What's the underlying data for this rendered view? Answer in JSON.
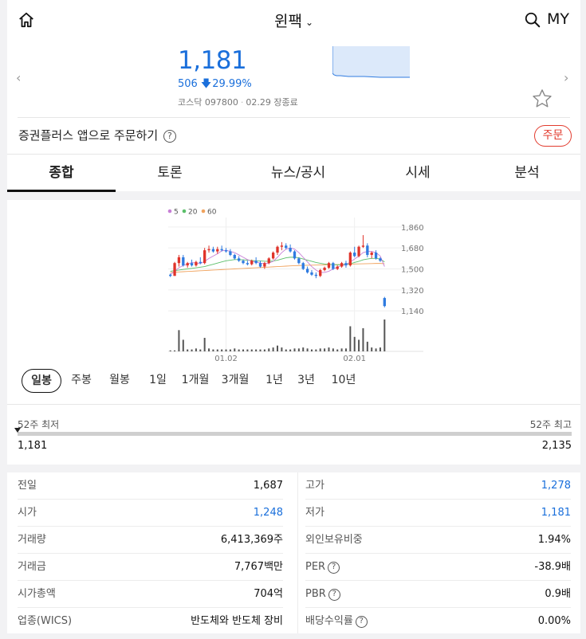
{
  "header": {
    "stock_name": "윈팩",
    "my_label": "MY"
  },
  "quote": {
    "price": "1,181",
    "change_amount": "506",
    "change_percent": "29.99%",
    "market": "코스닥",
    "code": "097800",
    "date_status": "02.29 장종료"
  },
  "order": {
    "prompt": "증권플러스 앱으로 주문하기",
    "button_label": "주문"
  },
  "tabs": [
    {
      "label": "종합",
      "active": true
    },
    {
      "label": "토론",
      "active": false
    },
    {
      "label": "뉴스/공시",
      "active": false
    },
    {
      "label": "시세",
      "active": false
    },
    {
      "label": "분석",
      "active": false
    }
  ],
  "chart_data": {
    "type": "candlestick",
    "legend": [
      "5",
      "20",
      "60"
    ],
    "legend_colors": [
      "#c77fd6",
      "#5bbf6a",
      "#f0a35e"
    ],
    "y_ticks": [
      "1,860",
      "1,680",
      "1,500",
      "1,320",
      "1,140"
    ],
    "y_tick_values": [
      1860,
      1680,
      1500,
      1320,
      1140
    ],
    "ylim": [
      1100,
      1900
    ],
    "x_ticks": [
      "01.02",
      "02.01"
    ],
    "x_tick_index": [
      13,
      43
    ],
    "up_color": "#e0332a",
    "down_color": "#2f7be0",
    "candles": [
      [
        1450,
        1460,
        1430,
        1440
      ],
      [
        1440,
        1560,
        1440,
        1550
      ],
      [
        1550,
        1620,
        1520,
        1600
      ],
      [
        1600,
        1620,
        1520,
        1530
      ],
      [
        1530,
        1560,
        1510,
        1550
      ],
      [
        1550,
        1580,
        1520,
        1530
      ],
      [
        1530,
        1570,
        1520,
        1560
      ],
      [
        1560,
        1600,
        1540,
        1550
      ],
      [
        1550,
        1680,
        1540,
        1660
      ],
      [
        1660,
        1700,
        1640,
        1670
      ],
      [
        1670,
        1690,
        1640,
        1650
      ],
      [
        1650,
        1690,
        1630,
        1670
      ],
      [
        1670,
        1700,
        1650,
        1660
      ],
      [
        1660,
        1680,
        1640,
        1650
      ],
      [
        1650,
        1670,
        1610,
        1620
      ],
      [
        1620,
        1630,
        1580,
        1590
      ],
      [
        1590,
        1610,
        1560,
        1570
      ],
      [
        1570,
        1580,
        1540,
        1550
      ],
      [
        1550,
        1570,
        1530,
        1540
      ],
      [
        1540,
        1580,
        1530,
        1570
      ],
      [
        1570,
        1600,
        1540,
        1550
      ],
      [
        1550,
        1570,
        1510,
        1520
      ],
      [
        1520,
        1560,
        1500,
        1550
      ],
      [
        1550,
        1600,
        1540,
        1590
      ],
      [
        1590,
        1650,
        1580,
        1640
      ],
      [
        1640,
        1700,
        1620,
        1690
      ],
      [
        1690,
        1730,
        1660,
        1700
      ],
      [
        1700,
        1720,
        1670,
        1680
      ],
      [
        1680,
        1710,
        1640,
        1650
      ],
      [
        1650,
        1660,
        1580,
        1590
      ],
      [
        1590,
        1600,
        1540,
        1550
      ],
      [
        1550,
        1560,
        1490,
        1500
      ],
      [
        1500,
        1520,
        1460,
        1470
      ],
      [
        1470,
        1490,
        1440,
        1450
      ],
      [
        1450,
        1470,
        1420,
        1440
      ],
      [
        1440,
        1500,
        1430,
        1490
      ],
      [
        1490,
        1520,
        1480,
        1510
      ],
      [
        1510,
        1560,
        1500,
        1550
      ],
      [
        1550,
        1560,
        1490,
        1500
      ],
      [
        1500,
        1530,
        1490,
        1520
      ],
      [
        1520,
        1560,
        1510,
        1550
      ],
      [
        1550,
        1570,
        1510,
        1530
      ],
      [
        1530,
        1650,
        1520,
        1640
      ],
      [
        1640,
        1690,
        1600,
        1610
      ],
      [
        1610,
        1700,
        1600,
        1690
      ],
      [
        1690,
        1790,
        1680,
        1700
      ],
      [
        1700,
        1720,
        1600,
        1620
      ],
      [
        1620,
        1650,
        1590,
        1640
      ],
      [
        1640,
        1660,
        1580,
        1590
      ],
      [
        1590,
        1600,
        1560,
        1570
      ],
      [
        1250,
        1260,
        1170,
        1181
      ]
    ],
    "ma5": [
      1450,
      1480,
      1510,
      1530,
      1540,
      1555,
      1550,
      1545,
      1565,
      1590,
      1610,
      1630,
      1655,
      1660,
      1650,
      1640,
      1620,
      1600,
      1580,
      1565,
      1560,
      1550,
      1545,
      1550,
      1565,
      1600,
      1640,
      1670,
      1680,
      1670,
      1640,
      1600,
      1560,
      1520,
      1490,
      1470,
      1470,
      1480,
      1500,
      1515,
      1530,
      1535,
      1560,
      1585,
      1610,
      1640,
      1650,
      1650,
      1640,
      1610,
      1520
    ],
    "ma20": [
      1480,
      1485,
      1490,
      1495,
      1500,
      1505,
      1510,
      1515,
      1520,
      1530,
      1540,
      1550,
      1560,
      1570,
      1575,
      1580,
      1580,
      1578,
      1575,
      1572,
      1570,
      1568,
      1566,
      1565,
      1568,
      1575,
      1585,
      1595,
      1600,
      1600,
      1595,
      1585,
      1575,
      1565,
      1555,
      1548,
      1542,
      1538,
      1536,
      1535,
      1536,
      1538,
      1545,
      1555,
      1565,
      1578,
      1585,
      1590,
      1590,
      1585,
      1560
    ],
    "ma60": [
      1470,
      1472,
      1474,
      1476,
      1478,
      1480,
      1482,
      1484,
      1486,
      1488,
      1490,
      1492,
      1494,
      1496,
      1498,
      1500,
      1502,
      1504,
      1506,
      1508,
      1510,
      1512,
      1514,
      1516,
      1518,
      1520,
      1522,
      1524,
      1526,
      1528,
      1529,
      1530,
      1531,
      1532,
      1533,
      1534,
      1535,
      1536,
      1537,
      1538,
      1539,
      1540,
      1541,
      1542,
      1543,
      1544,
      1545,
      1546,
      1547,
      1547,
      1545
    ],
    "volume": [
      1,
      1,
      22,
      12,
      2,
      2,
      3,
      2,
      14,
      3,
      2,
      2,
      2,
      2,
      2,
      3,
      2,
      2,
      2,
      2,
      2,
      2,
      2,
      3,
      4,
      6,
      4,
      2,
      2,
      3,
      3,
      4,
      3,
      2,
      2,
      3,
      3,
      4,
      3,
      2,
      3,
      3,
      26,
      15,
      12,
      24,
      10,
      4,
      3,
      4,
      33
    ]
  },
  "periods": [
    {
      "label": "일봉",
      "active": true
    },
    {
      "label": "주봉",
      "active": false
    },
    {
      "label": "월봉",
      "active": false
    },
    {
      "label": "1일",
      "active": false
    },
    {
      "label": "1개월",
      "active": false
    },
    {
      "label": "3개월",
      "active": false
    },
    {
      "label": "1년",
      "active": false
    },
    {
      "label": "3년",
      "active": false
    },
    {
      "label": "10년",
      "active": false
    }
  ],
  "range52": {
    "low_label": "52주 최저",
    "high_label": "52주 최고",
    "low_value": "1,181",
    "high_value": "2,135",
    "position": 0.0
  },
  "stats_left": [
    {
      "label": "전일",
      "value": "1,687",
      "blue": false
    },
    {
      "label": "시가",
      "value": "1,248",
      "blue": true
    },
    {
      "label": "거래량",
      "value": "6,413,369주",
      "blue": false
    },
    {
      "label": "거래금",
      "value": "7,767백만",
      "blue": false
    },
    {
      "label": "시가총액",
      "value": "704억",
      "blue": false
    },
    {
      "label": "업종(WICS)",
      "value": "반도체와 반도체 장비",
      "blue": false
    }
  ],
  "stats_right": [
    {
      "label": "고가",
      "value": "1,278",
      "blue": true,
      "help": false
    },
    {
      "label": "저가",
      "value": "1,181",
      "blue": true,
      "help": false
    },
    {
      "label": "외인보유비중",
      "value": "1.94%",
      "blue": false,
      "help": false
    },
    {
      "label": "PER",
      "value": "-38.9배",
      "blue": false,
      "help": true
    },
    {
      "label": "PBR",
      "value": "0.9배",
      "blue": false,
      "help": true
    },
    {
      "label": "배당수익률",
      "value": "0.00%",
      "blue": false,
      "help": true
    }
  ],
  "colors": {
    "accent_blue": "#1a6fdb",
    "accent_red": "#e23b2e"
  }
}
